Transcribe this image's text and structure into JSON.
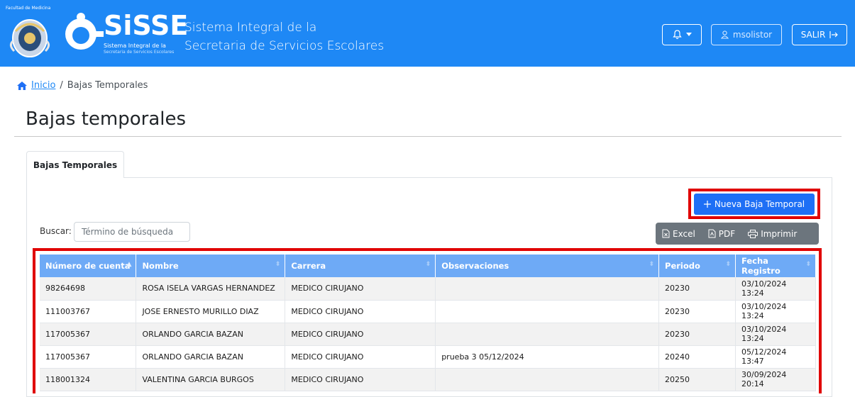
{
  "header": {
    "crest_text": "Facultad de Medicina",
    "logo_text": "SiSSE",
    "logo_sub1": "Sistema Integral de la",
    "logo_sub2": "Secretaria de Servicios Escolares",
    "title_line1": "Sistema Integral de la",
    "title_line2": "Secretaria de Servicios Escolares",
    "user_label": "msolistor",
    "logout_label": "SALIR",
    "bar_color": "#1e88f5"
  },
  "breadcrumb": {
    "home_label": "Inicio",
    "separator": "/",
    "current": "Bajas Temporales"
  },
  "page": {
    "title": "Bajas temporales",
    "tab_label": "Bajas Temporales"
  },
  "actions": {
    "new_label": "Nueva Baja Temporal",
    "search_label": "Buscar:",
    "search_placeholder": "Término de búsqueda",
    "excel_label": "Excel",
    "pdf_label": "PDF",
    "print_label": "Imprimir"
  },
  "table": {
    "columns": [
      "Número de cuenta",
      "Nombre",
      "Carrera",
      "Observaciones",
      "Periodo",
      "Fecha Registro"
    ],
    "rows": [
      [
        "98264698",
        "ROSA ISELA VARGAS HERNANDEZ",
        "MEDICO CIRUJANO",
        "",
        "20230",
        "03/10/2024 13:24"
      ],
      [
        "111003767",
        "JOSE ERNESTO MURILLO DIAZ",
        "MEDICO CIRUJANO",
        "",
        "20230",
        "03/10/2024 13:24"
      ],
      [
        "117005367",
        "ORLANDO GARCIA BAZAN",
        "MEDICO CIRUJANO",
        "",
        "20230",
        "03/10/2024 13:24"
      ],
      [
        "117005367",
        "ORLANDO GARCIA BAZAN",
        "MEDICO CIRUJANO",
        "prueba 3 05/12/2024",
        "20240",
        "05/12/2024 13:47"
      ],
      [
        "118001324",
        "VALENTINA GARCIA BURGOS",
        "MEDICO CIRUJANO",
        "",
        "20250",
        "30/09/2024 20:14"
      ]
    ]
  },
  "colors": {
    "accent": "#1e6ff5",
    "highlight": "#e00000",
    "table_header": "#6eaaf6"
  }
}
